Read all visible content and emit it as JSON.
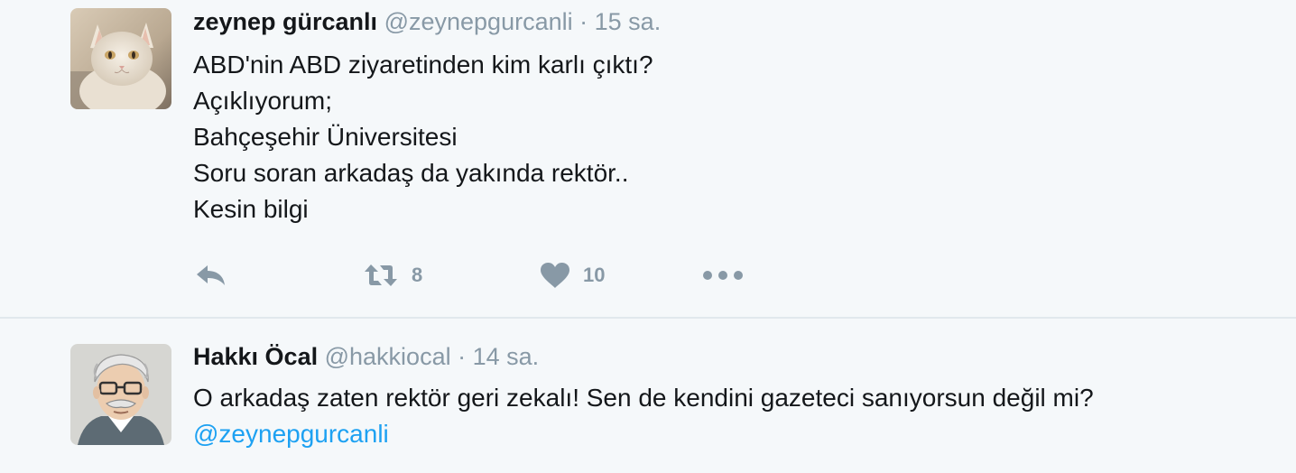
{
  "tweets": [
    {
      "fullname": "zeynep gürcanlı",
      "handle": "@zeynepgurcanli",
      "separator": "·",
      "time": "15 sa.",
      "lines": [
        "ABD'nin ABD ziyaretinden kim karlı çıktı?",
        "Açıklıyorum;",
        "Bahçeşehir Üniversitesi",
        "Soru soran arkadaş da yakında rektör..",
        "Kesin bilgi"
      ],
      "avatar_icon": "cat-avatar",
      "actions": {
        "reply_icon": "reply-icon",
        "retweet_icon": "retweet-icon",
        "retweet_count": "8",
        "like_icon": "heart-icon",
        "like_count": "10",
        "more_icon": "more-icon"
      }
    },
    {
      "fullname": "Hakkı Öcal",
      "handle": "@hakkiocal",
      "separator": "·",
      "time": "14 sa.",
      "lines": [
        "O arkadaş zaten rektör geri zekalı! Sen de kendini gazeteci sanıyorsun değil mi?"
      ],
      "mention": "@zeynepgurcanli",
      "avatar_icon": "cartoon-man-avatar"
    }
  ],
  "colors": {
    "background": "#f5f8fa",
    "text": "#14171a",
    "muted": "#8899a6",
    "link": "#1da1f2",
    "divider": "#e1e8ed"
  }
}
